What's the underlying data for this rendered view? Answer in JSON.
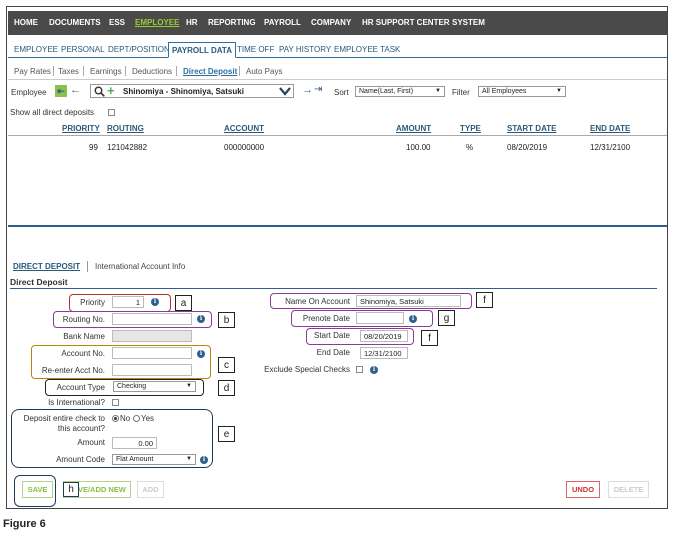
{
  "top_nav": [
    "HOME",
    "DOCUMENTS",
    "ESS",
    "EMPLOYEE",
    "HR",
    "REPORTING",
    "PAYROLL",
    "COMPANY",
    "HR SUPPORT CENTER",
    "SYSTEM"
  ],
  "second_tabs": [
    "EMPLOYEE",
    "PERSONAL",
    "DEPT/POSITION",
    "PAYROLL DATA",
    "TIME OFF",
    "PAY HISTORY",
    "EMPLOYEE TASK"
  ],
  "third_tabs": [
    "Pay Rates",
    "Taxes",
    "Earnings",
    "Deductions",
    "Direct Deposit",
    "Auto Pays"
  ],
  "employee_bar": {
    "label": "Employee",
    "employee_value": "Shinomiya - Shinomiya, Satsuki",
    "sort_label": "Sort",
    "sort_value": "Name(Last, First)",
    "filter_label": "Filter",
    "filter_value": "All Employees"
  },
  "show_all_label": "Show all direct deposits",
  "grid": {
    "headers": [
      "PRIORITY",
      "ROUTING",
      "ACCOUNT",
      "AMOUNT",
      "TYPE",
      "START DATE",
      "END DATE"
    ],
    "rows": [
      [
        "99",
        "121042882",
        "000000000",
        "100.00",
        "%",
        "08/20/2019",
        "12/31/2100"
      ]
    ]
  },
  "section_tabs": {
    "direct_deposit": "DIRECT DEPOSIT",
    "international": "International Account Info"
  },
  "section_title": "Direct Deposit",
  "form_left": {
    "priority_label": "Priority",
    "priority_value": "1",
    "routing_label": "Routing No.",
    "bank_label": "Bank Name",
    "account_label": "Account No.",
    "reenter_label": "Re-enter Acct No.",
    "account_type_label": "Account Type",
    "account_type_value": "Checking",
    "international_label": "Is International?",
    "deposit_entire_label_1": "Deposit entire check to",
    "deposit_entire_label_2": "this account?",
    "radio_no": "No",
    "radio_yes": "Yes",
    "amount_label": "Amount",
    "amount_value": "0.00",
    "amount_code_label": "Amount Code",
    "amount_code_value": "Flat Amount"
  },
  "form_right": {
    "name_label": "Name On Account",
    "name_value": "Shinomiya, Satsuki",
    "prenote_label": "Prenote Date",
    "start_label": "Start Date",
    "start_value": "08/20/2019",
    "end_label": "End Date",
    "end_value": "12/31/2100",
    "exclude_label": "Exclude Special Checks"
  },
  "annotations": [
    "a",
    "b",
    "c",
    "d",
    "e",
    "f",
    "g",
    "f",
    "h"
  ],
  "buttons": {
    "save": "SAVE",
    "save_add": "SAVE/ADD NEW",
    "add": "ADD",
    "undo": "UNDO",
    "delete": "DELETE"
  },
  "caption": "Figure 6",
  "colors": {
    "nav_bg": "#4a4a4a",
    "active_nav": "#9acd32",
    "tab_blue": "#2f6f9f",
    "highlight_red": "#a33",
    "highlight_purple": "#8a3a9a",
    "highlight_gold": "#b8860b",
    "highlight_navy": "#1e3a5f"
  }
}
